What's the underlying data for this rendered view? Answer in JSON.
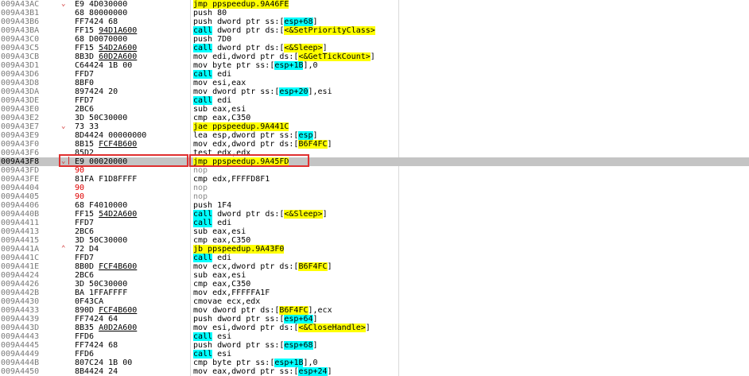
{
  "rows": [
    {
      "addr": "009A43AC",
      "arrow": "v",
      "bytes": [
        {
          "t": "E9 4D030000"
        }
      ],
      "instr": [
        {
          "t": "jmp ppspeedup.9A46FE",
          "c": "hl"
        }
      ]
    },
    {
      "addr": "009A43B1",
      "arrow": "",
      "bytes": [
        {
          "t": "68 80000000"
        }
      ],
      "instr": [
        {
          "t": "push 80"
        }
      ]
    },
    {
      "addr": "009A43B6",
      "arrow": "",
      "bytes": [
        {
          "t": "FF7424 68"
        }
      ],
      "instr": [
        {
          "t": "push dword ptr ss:["
        },
        {
          "t": "esp+68",
          "c": "cy"
        },
        {
          "t": "]"
        }
      ]
    },
    {
      "addr": "009A43BA",
      "arrow": "",
      "bytes": [
        {
          "t": "FF15 "
        },
        {
          "t": "94D1A600",
          "u": true
        }
      ],
      "instr": [
        {
          "t": "call",
          "c": "cy"
        },
        {
          "t": " dword ptr ds:["
        },
        {
          "t": "<&SetPriorityClass>",
          "c": "hl"
        }
      ]
    },
    {
      "addr": "009A43C0",
      "arrow": "",
      "bytes": [
        {
          "t": "68 D0070000"
        }
      ],
      "instr": [
        {
          "t": "push 7D0"
        }
      ]
    },
    {
      "addr": "009A43C5",
      "arrow": "",
      "bytes": [
        {
          "t": "FF15 "
        },
        {
          "t": "54D2A600",
          "u": true
        }
      ],
      "instr": [
        {
          "t": "call",
          "c": "cy"
        },
        {
          "t": " dword ptr ds:["
        },
        {
          "t": "<&Sleep>",
          "c": "hl"
        },
        {
          "t": "]"
        }
      ]
    },
    {
      "addr": "009A43CB",
      "arrow": "",
      "bytes": [
        {
          "t": "8B3D "
        },
        {
          "t": "60D2A600",
          "u": true
        }
      ],
      "instr": [
        {
          "t": "mov edi,dword ptr ds:["
        },
        {
          "t": "<&GetTickCount>",
          "c": "hl"
        },
        {
          "t": "]"
        }
      ]
    },
    {
      "addr": "009A43D1",
      "arrow": "",
      "bytes": [
        {
          "t": "C64424 1B 00"
        }
      ],
      "instr": [
        {
          "t": "mov byte ptr ss:["
        },
        {
          "t": "esp+1B",
          "c": "cy"
        },
        {
          "t": "],0"
        }
      ]
    },
    {
      "addr": "009A43D6",
      "arrow": "",
      "bytes": [
        {
          "t": "FFD7"
        }
      ],
      "instr": [
        {
          "t": "call",
          "c": "cy"
        },
        {
          "t": " edi"
        }
      ]
    },
    {
      "addr": "009A43D8",
      "arrow": "",
      "bytes": [
        {
          "t": "8BF0"
        }
      ],
      "instr": [
        {
          "t": "mov esi,eax"
        }
      ]
    },
    {
      "addr": "009A43DA",
      "arrow": "",
      "bytes": [
        {
          "t": "897424 20"
        }
      ],
      "instr": [
        {
          "t": "mov dword ptr ss:["
        },
        {
          "t": "esp+20",
          "c": "cy"
        },
        {
          "t": "],esi"
        }
      ]
    },
    {
      "addr": "009A43DE",
      "arrow": "",
      "bytes": [
        {
          "t": "FFD7"
        }
      ],
      "instr": [
        {
          "t": "call",
          "c": "cy"
        },
        {
          "t": " edi"
        }
      ]
    },
    {
      "addr": "009A43E0",
      "arrow": "",
      "bytes": [
        {
          "t": "2BC6"
        }
      ],
      "instr": [
        {
          "t": "sub eax,esi"
        }
      ]
    },
    {
      "addr": "009A43E2",
      "arrow": "",
      "bytes": [
        {
          "t": "3D 50C30000"
        }
      ],
      "instr": [
        {
          "t": "cmp eax,C350"
        }
      ]
    },
    {
      "addr": "009A43E7",
      "arrow": "v",
      "bytes": [
        {
          "t": "73 33"
        }
      ],
      "instr": [
        {
          "t": "jae ppspeedup.9A441C",
          "c": "hl"
        }
      ]
    },
    {
      "addr": "009A43E9",
      "arrow": "",
      "bytes": [
        {
          "t": "8D4424 00000000"
        }
      ],
      "instr": [
        {
          "t": "lea esp,dword ptr ss:["
        },
        {
          "t": "esp",
          "c": "cy"
        },
        {
          "t": "]"
        }
      ]
    },
    {
      "addr": "009A43F0",
      "arrow": "",
      "bytes": [
        {
          "t": "8B15 "
        },
        {
          "t": "FCF4B600",
          "u": true
        }
      ],
      "instr": [
        {
          "t": "mov edx,dword ptr ds:["
        },
        {
          "t": "B6F4FC",
          "c": "hl"
        },
        {
          "t": "]"
        }
      ]
    },
    {
      "addr": "009A43F6",
      "arrow": "",
      "bytes": [
        {
          "t": "85D2"
        }
      ],
      "instr": [
        {
          "t": "test edx,edx"
        }
      ]
    },
    {
      "addr": "009A43F8",
      "arrow": "v",
      "sel": true,
      "bytes": [
        {
          "t": "E9 00020000"
        }
      ],
      "instr": [
        {
          "t": "jmp ppspeedup.9A45FD",
          "c": "hl"
        }
      ]
    },
    {
      "addr": "009A43FD",
      "arrow": "",
      "bytes": [
        {
          "t": "90"
        }
      ],
      "redbytes": true,
      "nop": true,
      "instr": [
        {
          "t": "nop"
        }
      ]
    },
    {
      "addr": "009A43FE",
      "arrow": "",
      "bytes": [
        {
          "t": "81FA F1D8FFFF"
        }
      ],
      "instr": [
        {
          "t": "cmp edx,FFFFD8F1"
        }
      ]
    },
    {
      "addr": "009A4404",
      "arrow": "",
      "bytes": [
        {
          "t": "90"
        }
      ],
      "redbytes": true,
      "nop": true,
      "instr": [
        {
          "t": "nop"
        }
      ]
    },
    {
      "addr": "009A4405",
      "arrow": "",
      "bytes": [
        {
          "t": "90"
        }
      ],
      "redbytes": true,
      "nop": true,
      "instr": [
        {
          "t": "nop"
        }
      ]
    },
    {
      "addr": "009A4406",
      "arrow": "",
      "bytes": [
        {
          "t": "68 F4010000"
        }
      ],
      "instr": [
        {
          "t": "push 1F4"
        }
      ]
    },
    {
      "addr": "009A440B",
      "arrow": "",
      "bytes": [
        {
          "t": "FF15 "
        },
        {
          "t": "54D2A600",
          "u": true
        }
      ],
      "instr": [
        {
          "t": "call",
          "c": "cy"
        },
        {
          "t": " dword ptr ds:["
        },
        {
          "t": "<&Sleep>",
          "c": "hl"
        },
        {
          "t": "]"
        }
      ]
    },
    {
      "addr": "009A4411",
      "arrow": "",
      "bytes": [
        {
          "t": "FFD7"
        }
      ],
      "instr": [
        {
          "t": "call",
          "c": "cy"
        },
        {
          "t": " edi"
        }
      ]
    },
    {
      "addr": "009A4413",
      "arrow": "",
      "bytes": [
        {
          "t": "2BC6"
        }
      ],
      "instr": [
        {
          "t": "sub eax,esi"
        }
      ]
    },
    {
      "addr": "009A4415",
      "arrow": "",
      "bytes": [
        {
          "t": "3D 50C30000"
        }
      ],
      "instr": [
        {
          "t": "cmp eax,C350"
        }
      ]
    },
    {
      "addr": "009A441A",
      "arrow": "^",
      "bytes": [
        {
          "t": "72 D4"
        }
      ],
      "instr": [
        {
          "t": "jb ppspeedup.9A43F0",
          "c": "hl"
        }
      ]
    },
    {
      "addr": "009A441C",
      "arrow": "",
      "bytes": [
        {
          "t": "FFD7"
        }
      ],
      "instr": [
        {
          "t": "call",
          "c": "cy"
        },
        {
          "t": " edi"
        }
      ]
    },
    {
      "addr": "009A441E",
      "arrow": "",
      "bytes": [
        {
          "t": "8B0D "
        },
        {
          "t": "FCF4B600",
          "u": true
        }
      ],
      "instr": [
        {
          "t": "mov ecx,dword ptr ds:["
        },
        {
          "t": "B6F4FC",
          "c": "hl"
        },
        {
          "t": "]"
        }
      ]
    },
    {
      "addr": "009A4424",
      "arrow": "",
      "bytes": [
        {
          "t": "2BC6"
        }
      ],
      "instr": [
        {
          "t": "sub eax,esi"
        }
      ]
    },
    {
      "addr": "009A4426",
      "arrow": "",
      "bytes": [
        {
          "t": "3D 50C30000"
        }
      ],
      "instr": [
        {
          "t": "cmp eax,C350"
        }
      ]
    },
    {
      "addr": "009A442B",
      "arrow": "",
      "bytes": [
        {
          "t": "BA 1FFAFFFF"
        }
      ],
      "instr": [
        {
          "t": "mov edx,FFFFFA1F"
        }
      ]
    },
    {
      "addr": "009A4430",
      "arrow": "",
      "bytes": [
        {
          "t": "0F43CA"
        }
      ],
      "instr": [
        {
          "t": "cmovae ecx,edx"
        }
      ]
    },
    {
      "addr": "009A4433",
      "arrow": "",
      "bytes": [
        {
          "t": "890D "
        },
        {
          "t": "FCF4B600",
          "u": true
        }
      ],
      "instr": [
        {
          "t": "mov dword ptr ds:["
        },
        {
          "t": "B6F4FC",
          "c": "hl"
        },
        {
          "t": "],ecx"
        }
      ]
    },
    {
      "addr": "009A4439",
      "arrow": "",
      "bytes": [
        {
          "t": "FF7424 64"
        }
      ],
      "instr": [
        {
          "t": "push dword ptr ss:["
        },
        {
          "t": "esp+64",
          "c": "cy"
        },
        {
          "t": "]"
        }
      ]
    },
    {
      "addr": "009A443D",
      "arrow": "",
      "bytes": [
        {
          "t": "8B35 "
        },
        {
          "t": "A0D2A600",
          "u": true
        }
      ],
      "instr": [
        {
          "t": "mov esi,dword ptr ds:["
        },
        {
          "t": "<&CloseHandle>",
          "c": "hl"
        },
        {
          "t": "]"
        }
      ]
    },
    {
      "addr": "009A4443",
      "arrow": "",
      "bytes": [
        {
          "t": "FFD6"
        }
      ],
      "instr": [
        {
          "t": "call",
          "c": "cy"
        },
        {
          "t": " esi"
        }
      ]
    },
    {
      "addr": "009A4445",
      "arrow": "",
      "bytes": [
        {
          "t": "FF7424 68"
        }
      ],
      "instr": [
        {
          "t": "push dword ptr ss:["
        },
        {
          "t": "esp+68",
          "c": "cy"
        },
        {
          "t": "]"
        }
      ]
    },
    {
      "addr": "009A4449",
      "arrow": "",
      "bytes": [
        {
          "t": "FFD6"
        }
      ],
      "instr": [
        {
          "t": "call",
          "c": "cy"
        },
        {
          "t": " esi"
        }
      ]
    },
    {
      "addr": "009A444B",
      "arrow": "",
      "bytes": [
        {
          "t": "807C24 1B 00"
        }
      ],
      "instr": [
        {
          "t": "cmp byte ptr ss:["
        },
        {
          "t": "esp+1B",
          "c": "cy"
        },
        {
          "t": "],0"
        }
      ]
    },
    {
      "addr": "009A4450",
      "arrow": "",
      "bytes": [
        {
          "t": "8B4424 24"
        }
      ],
      "instr": [
        {
          "t": "mov eax,dword ptr ss:["
        },
        {
          "t": "esp+24",
          "c": "cy"
        },
        {
          "t": "]"
        }
      ]
    }
  ],
  "arrow_glyphs": {
    "v": "⌄",
    "^": "⌃"
  }
}
